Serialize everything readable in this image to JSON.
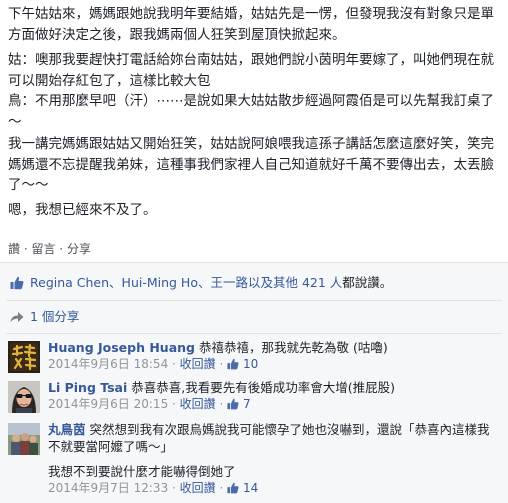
{
  "post": {
    "paragraphs": [
      "下午姑姑來，媽媽跟她說我明年要結婚，姑姑先是一愣，但發現我沒有對象只是單方面做好決定之後，跟我媽兩個人狂笑到屋頂快掀起來。",
      "姑：噢那我要趕快打電話給妳台南姑姑，跟她們說小茵明年要嫁了，叫她們現在就可以開始存紅包了，這樣比較大包\n鳥：不用那麼早吧（汗）⋯⋯是說如果大姑姑散步經過阿霞佰是可以先幫我訂桌了～",
      "我一講完媽媽跟姑姑又開始狂笑，姑姑說阿娘喂我這孫子講話怎麼這麼好笑，笑完媽媽還不忘提醒我弟妹，這種事我們家裡人自己知道就好千萬不要傳出去，太丟臉了～～",
      "嗯，我想已經來不及了。"
    ],
    "actions": {
      "like": "讚",
      "separator": " · ",
      "comment": "留言",
      "share": "分享"
    }
  },
  "likes": {
    "names": "Regina Chen、Hui-Ming Ho、王一路以及其他 421 人",
    "suffix": "都說讚。"
  },
  "shares": {
    "label": "1 個分享"
  },
  "comments": [
    {
      "author": "Huang Joseph Huang",
      "text": "恭禧恭禧，那我就先乾為敬 (咕嚕)",
      "date": "2014年9月6日 18:54",
      "reply": "收回讚",
      "likes": "10",
      "avatar": "avatar-calligraphy"
    },
    {
      "author": "Li Ping Tsai",
      "text": "恭喜恭喜,我看要先有後婚成功率會大增(推屁股)",
      "date": "2014年9月6日 20:15",
      "reply": "收回讚",
      "likes": "7",
      "avatar": "avatar-woman-sunglasses"
    },
    {
      "author": "丸鳥茵",
      "text": "突然想到我有次跟烏媽說我可能懷孕了她也沒嚇到，還說「恭喜內這樣我不就要當阿嬤了嗎～」",
      "text2": "我想不到要說什麼才能嚇得倒她了",
      "date": "2014年9月7日 12:33",
      "reply": "收回讚",
      "likes": "14",
      "avatar": "avatar-group-photo"
    }
  ],
  "colors": {
    "link": "#365899",
    "meta": "#90949c",
    "feedback_bg": "#f6f7f9"
  }
}
